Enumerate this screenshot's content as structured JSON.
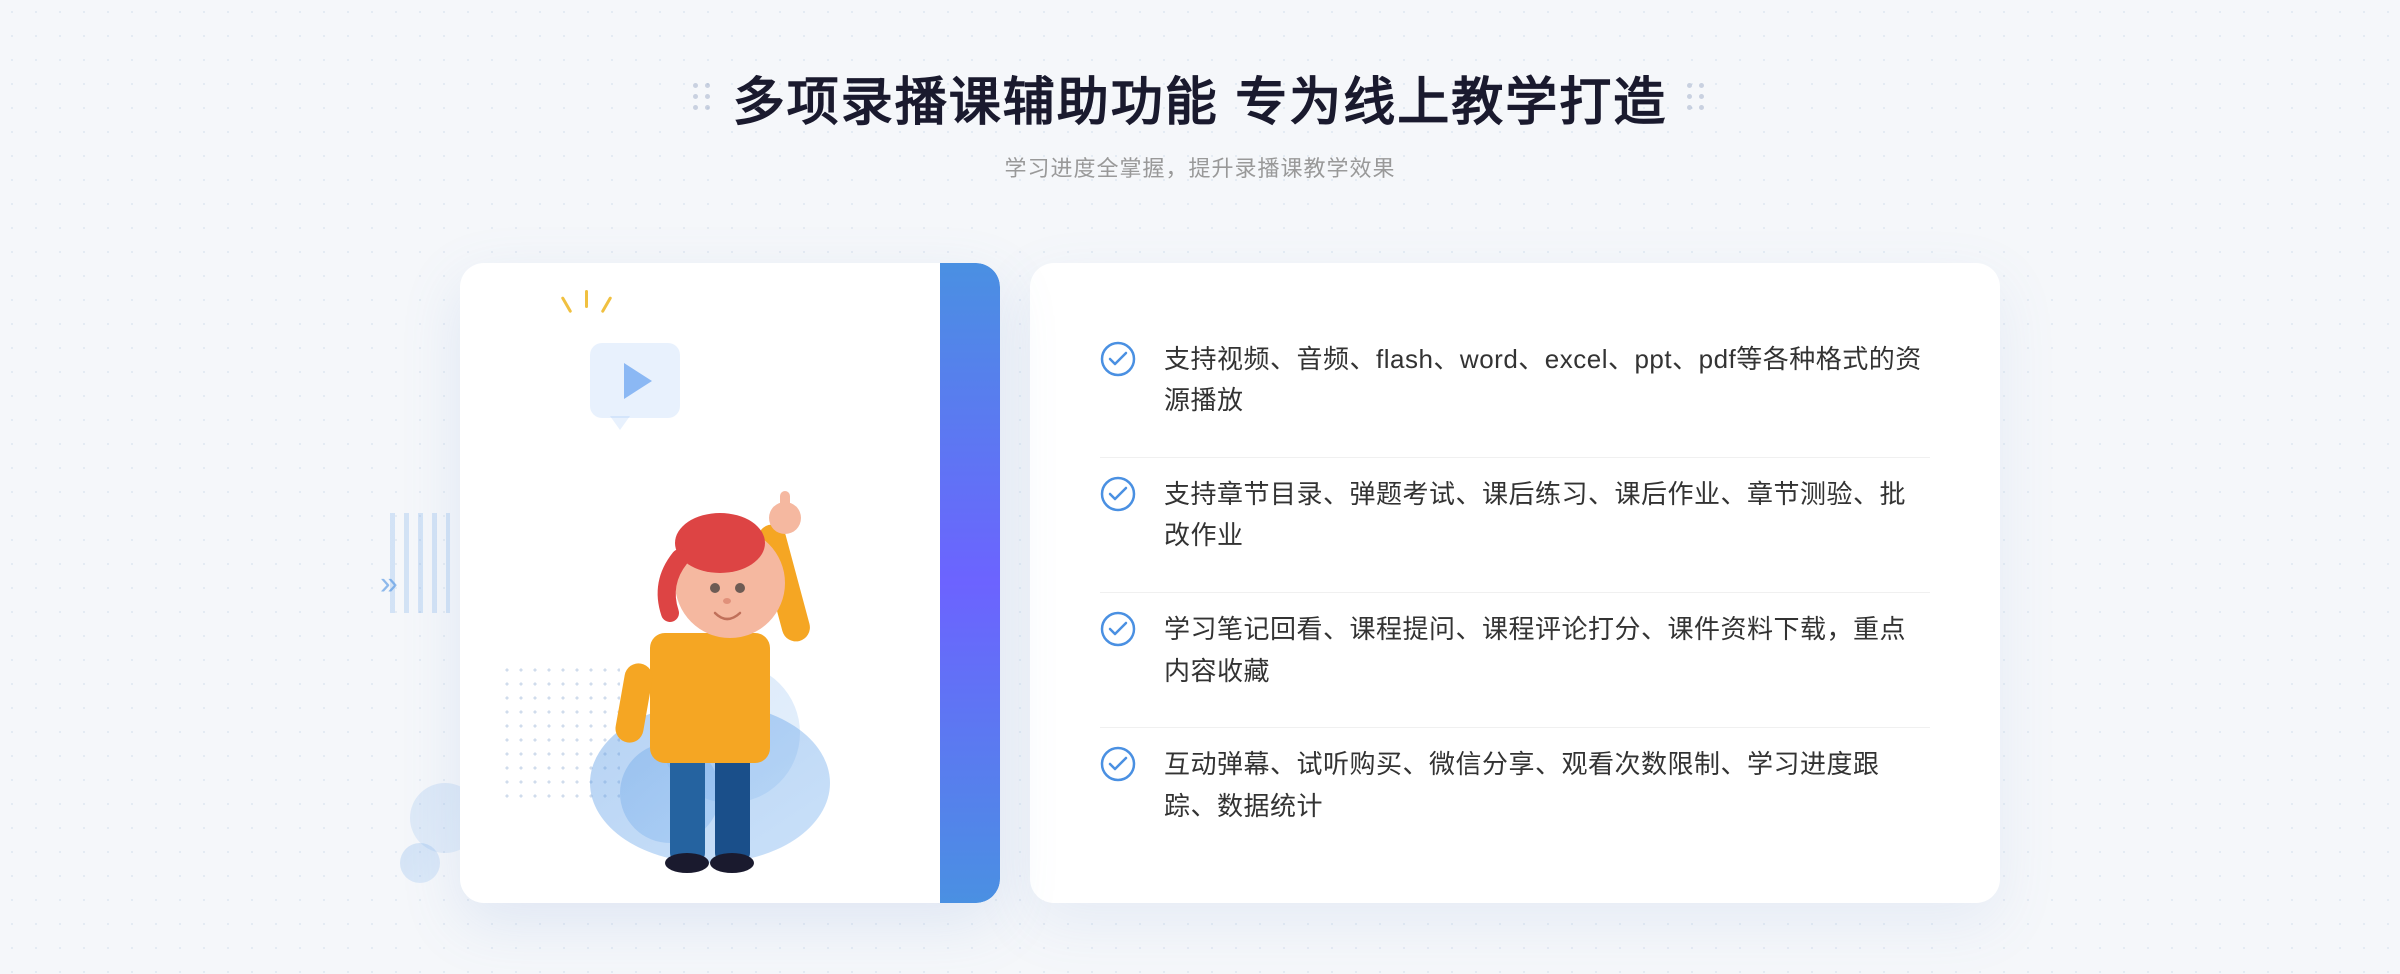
{
  "header": {
    "title": "多项录播课辅助功能 专为线上教学打造",
    "subtitle": "学习进度全掌握，提升录播课教学效果"
  },
  "features": [
    {
      "id": 1,
      "text": "支持视频、音频、flash、word、excel、ppt、pdf等各种格式的资源播放"
    },
    {
      "id": 2,
      "text": "支持章节目录、弹题考试、课后练习、课后作业、章节测验、批改作业"
    },
    {
      "id": 3,
      "text": "学习笔记回看、课程提问、课程评论打分、课件资料下载，重点内容收藏"
    },
    {
      "id": 4,
      "text": "互动弹幕、试听购买、微信分享、观看次数限制、学习进度跟踪、数据统计"
    }
  ],
  "colors": {
    "primary": "#4a90e2",
    "accent": "#6c63ff",
    "text_dark": "#1a1a2e",
    "text_gray": "#999",
    "feature_text": "#333"
  },
  "icons": {
    "check": "circle-check",
    "play": "play-triangle",
    "arrow": "double-chevron"
  }
}
